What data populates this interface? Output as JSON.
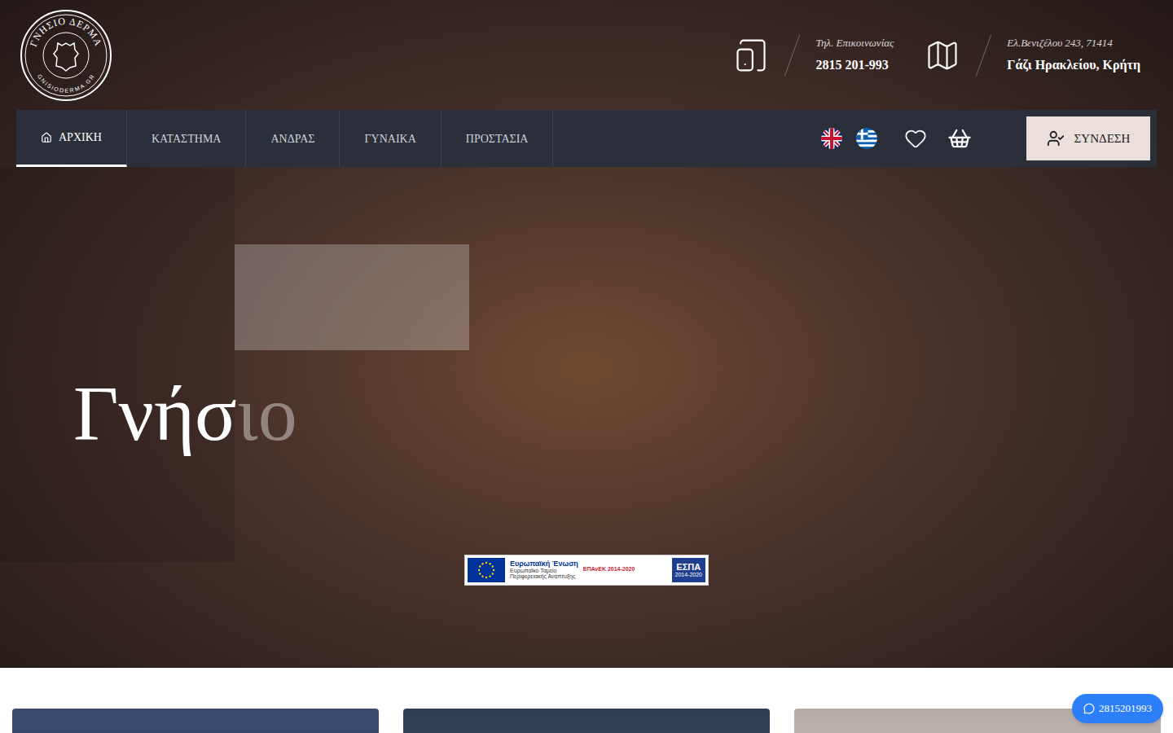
{
  "logo": {
    "top": "ΓΝΗΣΙΟ ΔΕΡΜΑ",
    "bottom": "GNISIODERMA.GR"
  },
  "contacts": [
    {
      "kind": "phone",
      "label": "Τηλ. Επικοινωνίας",
      "value": "2815 201-993"
    },
    {
      "kind": "map",
      "label": "Ελ.Βενιζέλου 243, 71414",
      "value": "Γάζι Ηρακλείου, Κρήτη"
    }
  ],
  "nav": [
    {
      "label": "ΑΡΧΙΚΗ",
      "selected": true
    },
    {
      "label": "ΚΑΤΑΣΤΗΜΑ",
      "selected": false
    },
    {
      "label": "ΑΝΔΡΑΣ",
      "selected": false
    },
    {
      "label": "ΓΥΝΑΙΚΑ",
      "selected": false
    },
    {
      "label": "ΠΡΟΣΤΑΣΙΑ",
      "selected": false
    }
  ],
  "languages": [
    {
      "kind": "uk"
    },
    {
      "kind": "gr"
    }
  ],
  "login": "ΣΥΝΔΕΣΗ",
  "hero": {
    "title_shown": "Γνήσ",
    "title_fading": "ιο"
  },
  "espa": {
    "eu": "Ευρωπαϊκή Ένωση",
    "fund1": "Ευρωπαϊκό Ταμείο",
    "fund2": "Περιφερειακής Ανάπτυξης",
    "program": "ΕΠΑνΕΚ 2014-2020",
    "brand": "ΕΣΠΑ",
    "years": "2014-2020"
  },
  "chat": {
    "number": "2815201993"
  }
}
